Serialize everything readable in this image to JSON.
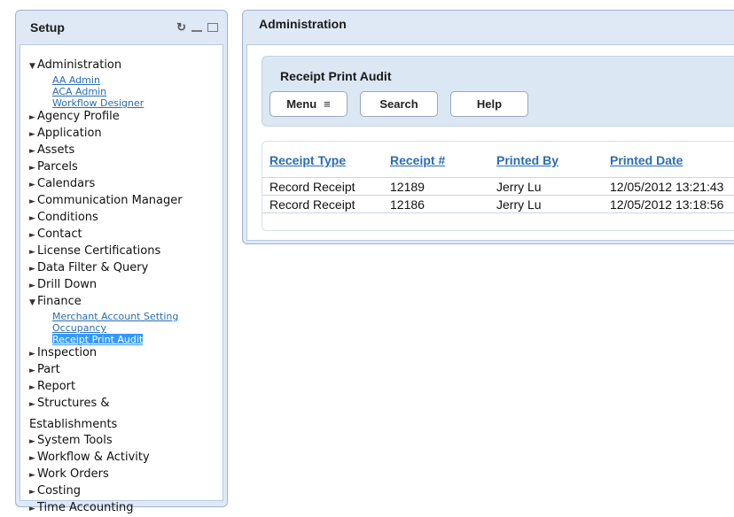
{
  "setup": {
    "title": "Setup",
    "tree": [
      {
        "label": "Administration",
        "expanded": true,
        "children": [
          "AA Admin",
          "ACA Admin",
          "Workflow Designer"
        ]
      },
      {
        "label": "Agency Profile"
      },
      {
        "label": "Application"
      },
      {
        "label": "Assets"
      },
      {
        "label": "Parcels"
      },
      {
        "label": "Calendars"
      },
      {
        "label": "Communication Manager"
      },
      {
        "label": "Conditions"
      },
      {
        "label": "Contact"
      },
      {
        "label": "License Certifications"
      },
      {
        "label": "Data Filter & Query"
      },
      {
        "label": "Drill Down"
      },
      {
        "label": "Finance",
        "expanded": true,
        "children": [
          "Merchant Account Setting",
          "Occupancy",
          "Receipt Print Audit"
        ],
        "selected_child": "Receipt Print Audit"
      },
      {
        "label": "Inspection"
      },
      {
        "label": "Part"
      },
      {
        "label": "Report"
      },
      {
        "label": "Structures &",
        "continuation": "Establishments"
      },
      {
        "label": "System Tools"
      },
      {
        "label": "Workflow & Activity"
      },
      {
        "label": "Work Orders"
      },
      {
        "label": "Costing"
      },
      {
        "label": "Time Accounting"
      }
    ]
  },
  "admin": {
    "title": "Administration",
    "page_title": "Receipt Print Audit",
    "buttons": {
      "menu": "Menu",
      "search": "Search",
      "help": "Help"
    },
    "table": {
      "headers": [
        "Receipt Type",
        "Receipt #",
        "Printed By",
        "Printed Date"
      ],
      "rows": [
        [
          "Record Receipt",
          "12189",
          "Jerry Lu",
          "12/05/2012 13:21:43"
        ],
        [
          "Record Receipt",
          "12186",
          "Jerry Lu",
          "12/05/2012 13:18:56"
        ]
      ]
    }
  },
  "colors": {
    "link": "#2a6db5",
    "selected_bg": "#3399ff",
    "panel_bg": "#dfe9f5"
  }
}
